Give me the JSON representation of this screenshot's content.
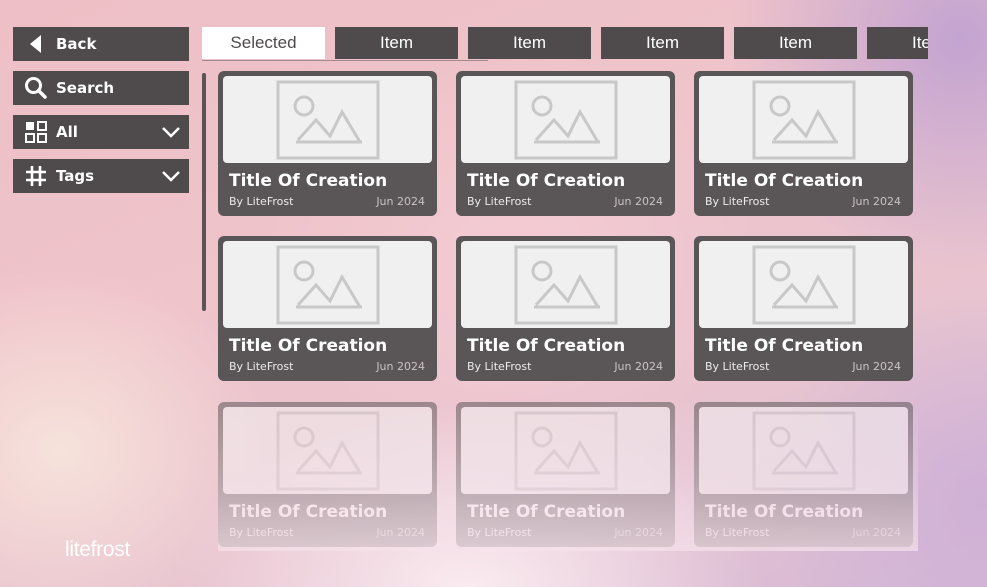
{
  "sidebar": {
    "back": {
      "label": "Back",
      "icon": "back-arrow-icon"
    },
    "search": {
      "label": "Search",
      "icon": "search-icon"
    },
    "all": {
      "label": "All",
      "icon": "grid-icon"
    },
    "tags": {
      "label": "Tags",
      "icon": "hash-icon"
    }
  },
  "tabs": [
    {
      "label": "Selected",
      "selected": true
    },
    {
      "label": "Item",
      "selected": false
    },
    {
      "label": "Item",
      "selected": false
    },
    {
      "label": "Item",
      "selected": false
    },
    {
      "label": "Item",
      "selected": false
    },
    {
      "label": "Item",
      "selected": false
    }
  ],
  "cards": [
    {
      "title": "Title Of Creation",
      "author": "By LiteFrost",
      "date": "Jun 2024"
    },
    {
      "title": "Title Of Creation",
      "author": "By LiteFrost",
      "date": "Jun 2024"
    },
    {
      "title": "Title Of Creation",
      "author": "By LiteFrost",
      "date": "Jun 2024"
    },
    {
      "title": "Title Of Creation",
      "author": "By LiteFrost",
      "date": "Jun 2024"
    },
    {
      "title": "Title Of Creation",
      "author": "By LiteFrost",
      "date": "Jun 2024"
    },
    {
      "title": "Title Of Creation",
      "author": "By LiteFrost",
      "date": "Jun 2024"
    },
    {
      "title": "Title Of Creation",
      "author": "By LiteFrost",
      "date": "Jun 2024"
    },
    {
      "title": "Title Of Creation",
      "author": "By LiteFrost",
      "date": "Jun 2024"
    },
    {
      "title": "Title Of Creation",
      "author": "By LiteFrost",
      "date": "Jun 2024"
    }
  ],
  "brand": {
    "logo": "litefrost"
  },
  "colors": {
    "panel": "#4f4a4c",
    "card": "#5a5557",
    "selected_tab": "#ffffff"
  }
}
